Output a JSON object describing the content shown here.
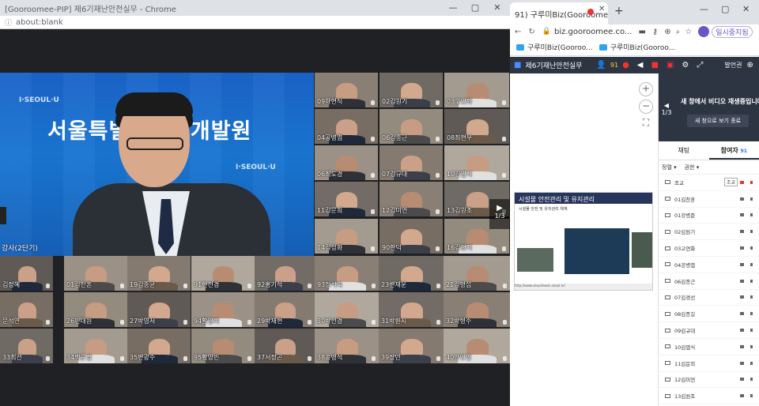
{
  "left_window": {
    "title": "[Gooroomee-PIP] 제6기재난안전실무 - Chrome",
    "window_controls": [
      "—",
      "▢",
      "✕"
    ],
    "address": "about:blank",
    "speaker_label": "강사(2단기)",
    "speaker_banner": "서울특별시인재개발원",
    "speaker_logo_text": "I·SEOUL·U",
    "pager": {
      "current": "1/3",
      "prev_icon": "arrow-left-icon",
      "next_icon": "arrow-right-icon"
    },
    "participants_grid": [
      {
        "label": "09하현식"
      },
      {
        "label": "02김원기"
      },
      {
        "label": "03고연화"
      },
      {
        "label": "04공병엽"
      },
      {
        "label": "06김종근"
      },
      {
        "label": "08최현우"
      },
      {
        "label": "06최도경"
      },
      {
        "label": "07김규대"
      },
      {
        "label": "10김엽식"
      },
      {
        "label": "11김문희"
      },
      {
        "label": "12김미연"
      },
      {
        "label": "13김원조"
      },
      {
        "label": "14김성화"
      },
      {
        "label": "90한덕"
      },
      {
        "label": "16김현지"
      },
      {
        "label": "김정혜"
      },
      {
        "label": "01김찬혼"
      },
      {
        "label": "19김종균"
      },
      {
        "label": "91현전경"
      },
      {
        "label": "92홍기석"
      },
      {
        "label": "93정석숙"
      },
      {
        "label": "23변재운"
      },
      {
        "label": "21김형섭"
      },
      {
        "label": "문석연"
      },
      {
        "label": "26민대원"
      },
      {
        "label": "27박영서"
      },
      {
        "label": "94황영미"
      },
      {
        "label": "29박재현"
      },
      {
        "label": "30박선경"
      },
      {
        "label": "31박환시"
      },
      {
        "label": "32박형수"
      },
      {
        "label": "33최선"
      },
      {
        "label": "34백문경"
      },
      {
        "label": "35변광수"
      },
      {
        "label": "95황영빈"
      },
      {
        "label": "37서정곤"
      },
      {
        "label": "38송병석"
      },
      {
        "label": "39장민"
      },
      {
        "label": "40안연영"
      }
    ]
  },
  "right_window": {
    "tabs": [
      {
        "label": "91) 구루미Biz(Gooroomee"
      },
      {
        "label": "+"
      }
    ],
    "window_controls": [
      "—",
      "▢",
      "✕"
    ],
    "address": "biz.gooroomee.co...",
    "pause_label": "일시중지됨",
    "bookmarks": [
      "구루미Biz(Gooroo...",
      "구루미Biz(Gooroo..."
    ],
    "app": {
      "room_title": "제6기재난안전실무",
      "participant_count": "91",
      "host_label": "발언권"
    },
    "slide": {
      "header": "시설물 안전관리 및 유지관리",
      "subtitle": "시설물 안전 및 유지관리 체계",
      "footer": "http://www.seoulinwon.seoul.kr/"
    },
    "video_panel": {
      "message": "새 창에서 비디오 재생중입니다.",
      "button": "새 창으로 보기 종료",
      "page": "1/3"
    },
    "side_tabs": {
      "chat": "채팅",
      "participants": "참여자",
      "participants_count": "91"
    },
    "sort_options": [
      "정렬 ▾",
      "권한 ▾"
    ],
    "participant_list": [
      {
        "name": "조교",
        "tag": "조교",
        "mic_muted": false
      },
      {
        "name": "01김찬혼",
        "mic_muted": true
      },
      {
        "name": "01강병준",
        "mic_muted": true
      },
      {
        "name": "02김원기",
        "mic_muted": true
      },
      {
        "name": "03고연화",
        "mic_muted": true
      },
      {
        "name": "04공병엽",
        "mic_muted": true
      },
      {
        "name": "06김종근",
        "mic_muted": true
      },
      {
        "name": "07김경선",
        "mic_muted": true
      },
      {
        "name": "08김종길",
        "mic_muted": true
      },
      {
        "name": "09김규대",
        "mic_muted": true
      },
      {
        "name": "10김엽식",
        "mic_muted": true
      },
      {
        "name": "11김문희",
        "mic_muted": true
      },
      {
        "name": "12김미연",
        "mic_muted": true
      },
      {
        "name": "13김원조",
        "mic_muted": true
      },
      {
        "name": "14김성화",
        "mic_muted": true
      }
    ]
  }
}
